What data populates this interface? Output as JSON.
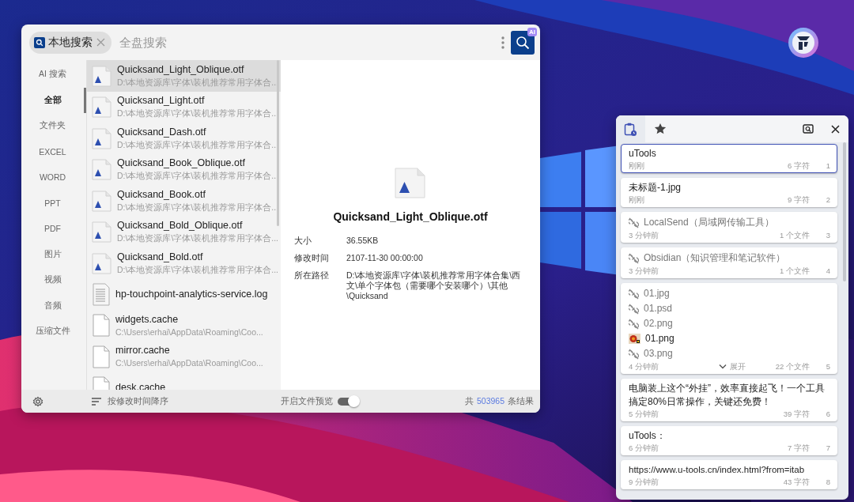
{
  "search_window": {
    "chip": {
      "label": "本地搜索"
    },
    "search_field": {
      "placeholder": "全盘搜索"
    },
    "ai_badge": "AI",
    "categories": [
      {
        "label": "AI 搜索",
        "selected": false
      },
      {
        "label": "全部",
        "selected": true
      },
      {
        "label": "文件夹",
        "selected": false
      },
      {
        "label": "EXCEL",
        "selected": false
      },
      {
        "label": "WORD",
        "selected": false
      },
      {
        "label": "PPT",
        "selected": false
      },
      {
        "label": "PDF",
        "selected": false
      },
      {
        "label": "图片",
        "selected": false
      },
      {
        "label": "视频",
        "selected": false
      },
      {
        "label": "音频",
        "selected": false
      },
      {
        "label": "压缩文件",
        "selected": false
      }
    ],
    "results": [
      {
        "kind": "font",
        "name": "Quicksand_Light_Oblique.otf",
        "path": "D:\\本地资源库\\字体\\装机推荐常用字体合...",
        "selected": true
      },
      {
        "kind": "font",
        "name": "Quicksand_Light.otf",
        "path": "D:\\本地资源库\\字体\\装机推荐常用字体合...",
        "selected": false
      },
      {
        "kind": "font",
        "name": "Quicksand_Dash.otf",
        "path": "D:\\本地资源库\\字体\\装机推荐常用字体合...",
        "selected": false
      },
      {
        "kind": "font",
        "name": "Quicksand_Book_Oblique.otf",
        "path": "D:\\本地资源库\\字体\\装机推荐常用字体合...",
        "selected": false
      },
      {
        "kind": "font",
        "name": "Quicksand_Book.otf",
        "path": "D:\\本地资源库\\字体\\装机推荐常用字体合...",
        "selected": false
      },
      {
        "kind": "font",
        "name": "Quicksand_Bold_Oblique.otf",
        "path": "D:\\本地资源库\\字体\\装机推荐常用字体合...",
        "selected": false
      },
      {
        "kind": "font",
        "name": "Quicksand_Bold.otf",
        "path": "D:\\本地资源库\\字体\\装机推荐常用字体合...",
        "selected": false
      },
      {
        "kind": "text",
        "name": "hp-touchpoint-analytics-service.log",
        "selected": false
      },
      {
        "kind": "file",
        "name": "widgets.cache",
        "path": "C:\\Users\\erhai\\AppData\\Roaming\\Coo...",
        "selected": false
      },
      {
        "kind": "file",
        "name": "mirror.cache",
        "path": "C:\\Users\\erhai\\AppData\\Roaming\\Coo...",
        "selected": false
      },
      {
        "kind": "file",
        "name": "desk.cache",
        "selected": false
      }
    ],
    "preview": {
      "title": "Quicksand_Light_Oblique.otf",
      "props": [
        {
          "label": "大小",
          "value": "36.55KB"
        },
        {
          "label": "修改时间",
          "value": "2107-11-30 00:00:00"
        },
        {
          "label": "所在路径",
          "value": "D:\\本地资源库\\字体\\装机推荐常用字体合集\\西文\\单个字体包（需要哪个安装哪个）\\其他\\Quicksand"
        }
      ]
    },
    "footer": {
      "sort": "按修改时间降序",
      "preview_toggle": {
        "label": "开启文件预览",
        "on": true
      },
      "total_prefix": "共",
      "total": "503965",
      "total_suffix": "条结果"
    }
  },
  "clipboard_window": {
    "tabs": [
      {
        "kind": "history",
        "selected": true
      },
      {
        "kind": "favorites",
        "selected": false
      }
    ],
    "items": [
      {
        "kind": "text",
        "text": "uTools",
        "time": "刚刚",
        "size": "6 字符",
        "index": "1",
        "selected": true
      },
      {
        "kind": "text",
        "text": "未标题-1.jpg",
        "time": "刚刚",
        "size": "9 字符",
        "index": "2",
        "selected": false
      },
      {
        "kind": "files",
        "files": [
          {
            "name": "LocalSend（局域网传输工具）",
            "missing": true
          }
        ],
        "time": "3 分钟前",
        "size": "1 个文件",
        "index": "3",
        "selected": false
      },
      {
        "kind": "files",
        "files": [
          {
            "name": "Obsidian（知识管理和笔记软件）",
            "missing": true
          }
        ],
        "time": "3 分钟前",
        "size": "1 个文件",
        "index": "4",
        "selected": false
      },
      {
        "kind": "files",
        "files": [
          {
            "name": "01.jpg",
            "missing": true
          },
          {
            "name": "01.psd",
            "missing": true
          },
          {
            "name": "02.png",
            "missing": true
          },
          {
            "name": "01.png",
            "missing": false
          },
          {
            "name": "03.png",
            "missing": true
          }
        ],
        "expand": "展开",
        "time": "4 分钟前",
        "size": "22 个文件",
        "index": "5",
        "selected": false
      },
      {
        "kind": "text",
        "text": "电脑装上这个“外挂”，效率直接起飞！一个工具搞定80%日常操作，关键还免费！",
        "time": "5 分钟前",
        "size": "39 字符",
        "index": "6",
        "selected": false
      },
      {
        "kind": "text",
        "text": "uTools：",
        "time": "6 分钟前",
        "size": "7 字符",
        "index": "7",
        "selected": false
      },
      {
        "kind": "text",
        "text": "https://www.u-tools.cn/index.html?from=itab",
        "time": "9 分钟前",
        "size": "43 字符",
        "index": "8",
        "selected": false
      }
    ]
  }
}
